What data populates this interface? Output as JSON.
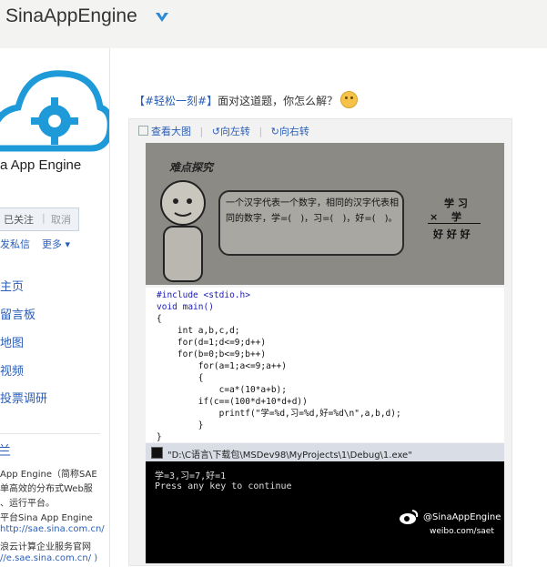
{
  "header": {
    "brand": "SinaAppEngine"
  },
  "sidebar": {
    "logo_text": "a App Engine",
    "follow_label": "已关注",
    "follow_sep": "|",
    "cancel_label": "取消",
    "message_label": "发私信",
    "more_label": "更多",
    "nav": [
      "主页",
      "留言板",
      "地图",
      "视频",
      "投票调研"
    ],
    "section_title": "兰",
    "bio_lines": [
      "App Engine（简称SAE",
      "单高效的分布式Web服",
      "、运行平台。",
      "平台Sina App Engine",
      "http://sae.sina.com.cn/",
      "浪云计算企业服务官网",
      "//e.sae.sina.com.cn/ )"
    ]
  },
  "post": {
    "tag": "【#轻松一刻#】",
    "text": "面对这道题，你怎么解？",
    "tools": {
      "view_large": "查看大图",
      "sep": "|",
      "rotate_left": "向左转",
      "rotate_right": "向右转"
    },
    "photo": {
      "heading": "难点探究",
      "bubble": "一个汉字代表一个数字，相同的汉字代表相同的数字，学=(　)，习=(　)，好=(　)。",
      "q_top": "学 习",
      "q_mid": "×　 学",
      "q_bot": "好 好 好"
    },
    "code_lines": [
      "#include <stdio.h>",
      "void main()",
      "{",
      "    int a,b,c,d;",
      "    for(d=1;d<=9;d++)",
      "    for(b=0;b<=9;b++)",
      "        for(a=1;a<=9;a++)",
      "        {",
      "            c=a*(10*a+b);",
      "        if(c==(100*d+10*d+d))",
      "            printf(\"学=%d,习=%d,好=%d\\n\",a,b,d);",
      "        }",
      "}"
    ],
    "console": {
      "title": "\"D:\\C语言\\下载包\\MSDev98\\MyProjects\\1\\Debug\\1.exe\"",
      "line1": "学=3,习=7,好=1",
      "line2": "Press any key to continue"
    },
    "watermark": {
      "name": "@SinaAppEngine",
      "url": "weibo.com/saet"
    }
  },
  "colors": {
    "link": "#2a5eb8",
    "logo_blue": "#1e9ad9"
  }
}
